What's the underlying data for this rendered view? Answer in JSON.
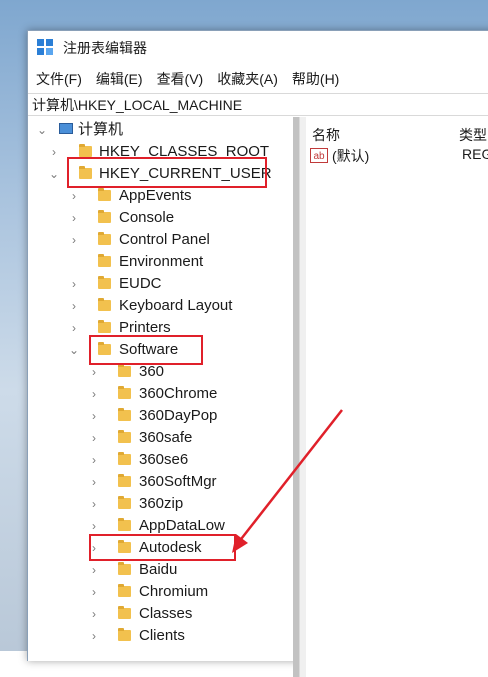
{
  "window": {
    "title": "注册表编辑器"
  },
  "menu": [
    "文件(F)",
    "编辑(E)",
    "查看(V)",
    "收藏夹(A)",
    "帮助(H)"
  ],
  "address": "计算机\\HKEY_LOCAL_MACHINE",
  "tree": {
    "root": "计算机",
    "hkcr": "HKEY_CLASSES_ROOT",
    "hkcu": "HKEY_CURRENT_USER",
    "hkcu_children": [
      "AppEvents",
      "Console",
      "Control Panel",
      "Environment",
      "EUDC",
      "Keyboard Layout",
      "Printers",
      "Software"
    ],
    "software_children": [
      "360",
      "360Chrome",
      "360DayPop",
      "360safe",
      "360se6",
      "360SoftMgr",
      "360zip",
      "AppDataLow",
      "Autodesk",
      "Baidu",
      "Chromium",
      "Classes",
      "Clients"
    ]
  },
  "values_pane": {
    "columns": [
      "名称",
      "类型"
    ],
    "rows": [
      {
        "name": "(默认)",
        "type": "REG",
        "icon": "ab"
      }
    ]
  },
  "highlights": [
    "HKEY_CURRENT_USER",
    "Software",
    "Autodesk"
  ],
  "colors": {
    "highlight": "#e0202a",
    "folder": "#f2c14e",
    "arrow": "#e0202a"
  }
}
